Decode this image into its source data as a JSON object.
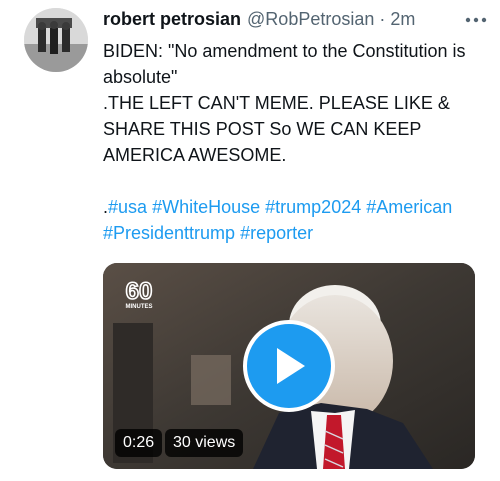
{
  "tweet": {
    "author_name": "robert petrosian",
    "handle": "@RobPetrosian",
    "separator": "·",
    "time": "2m",
    "lines": [
      "BIDEN: \"No amendment to the Constitution is absolute\"",
      ".THE LEFT CAN'T MEME. PLEASE LIKE & SHARE THIS POST So WE CAN KEEP AMERICA AWESOME."
    ],
    "hashtag_prefix": ".",
    "hashtags": [
      "#usa",
      "#WhiteHouse",
      "#trump2024",
      "#American",
      "#Presidenttrump",
      "#reporter"
    ]
  },
  "media": {
    "logo_top": "60",
    "logo_sub": "MINUTES",
    "duration": "0:26",
    "views": "30 views"
  },
  "colors": {
    "link": "#1d9bf0",
    "text": "#0f1419",
    "secondary": "#536471"
  },
  "icons": {
    "more": "more-icon",
    "play": "play-icon"
  }
}
